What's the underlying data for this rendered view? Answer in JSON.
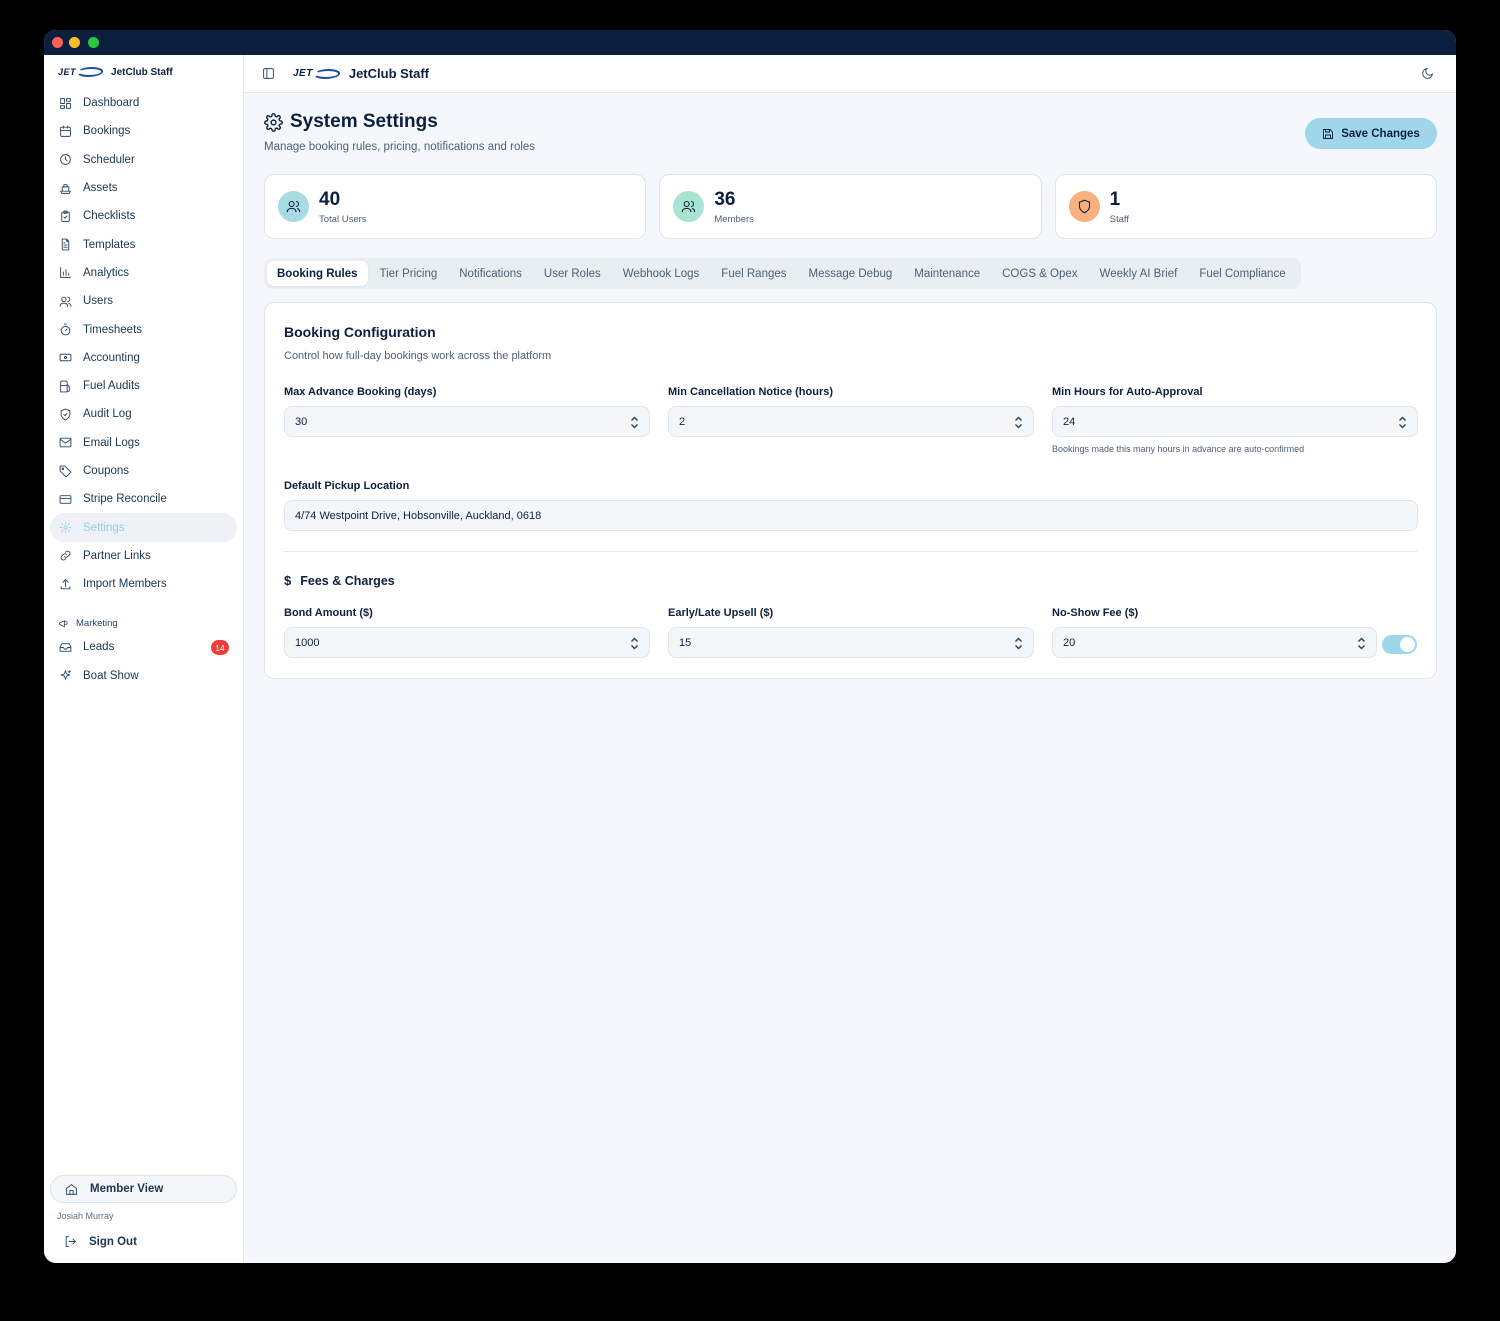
{
  "app": {
    "brand_logo_text": "JET",
    "brand_name": "JetClub Staff",
    "topbar_title": "JetClub Staff"
  },
  "sidebar": {
    "items": [
      {
        "label": "Dashboard",
        "icon": "layout-dashboard-icon"
      },
      {
        "label": "Bookings",
        "icon": "calendar-icon"
      },
      {
        "label": "Scheduler",
        "icon": "clock-icon"
      },
      {
        "label": "Assets",
        "icon": "boat-icon"
      },
      {
        "label": "Checklists",
        "icon": "clipboard-check-icon"
      },
      {
        "label": "Templates",
        "icon": "file-text-icon"
      },
      {
        "label": "Analytics",
        "icon": "bar-chart-icon"
      },
      {
        "label": "Users",
        "icon": "users-icon"
      },
      {
        "label": "Timesheets",
        "icon": "timer-icon"
      },
      {
        "label": "Accounting",
        "icon": "banknote-icon"
      },
      {
        "label": "Fuel Audits",
        "icon": "fuel-icon"
      },
      {
        "label": "Audit Log",
        "icon": "shield-check-icon"
      },
      {
        "label": "Email Logs",
        "icon": "mail-icon"
      },
      {
        "label": "Coupons",
        "icon": "tag-icon"
      },
      {
        "label": "Stripe Reconcile",
        "icon": "credit-card-icon"
      },
      {
        "label": "Settings",
        "icon": "gear-icon"
      },
      {
        "label": "Partner Links",
        "icon": "link-icon"
      },
      {
        "label": "Import Members",
        "icon": "upload-icon"
      }
    ],
    "marketing_label": "Marketing",
    "marketing_items": [
      {
        "label": "Leads",
        "icon": "inbox-icon",
        "badge": "14"
      },
      {
        "label": "Boat Show",
        "icon": "sparkles-icon"
      }
    ],
    "member_view": "Member View",
    "user_name": "Josiah Murray",
    "sign_out": "Sign Out"
  },
  "page": {
    "title": "System Settings",
    "subtitle": "Manage booking rules, pricing, notifications and roles",
    "save_label": "Save Changes"
  },
  "stats": [
    {
      "value": "40",
      "label": "Total Users",
      "color": "#a8dbe4"
    },
    {
      "value": "36",
      "label": "Members",
      "color": "#a9e4d2"
    },
    {
      "value": "1",
      "label": "Staff",
      "color": "#f9b07e"
    }
  ],
  "tabs": [
    "Booking Rules",
    "Tier Pricing",
    "Notifications",
    "User Roles",
    "Webhook Logs",
    "Fuel Ranges",
    "Message Debug",
    "Maintenance",
    "COGS & Opex",
    "Weekly AI Brief",
    "Fuel Compliance"
  ],
  "booking": {
    "title": "Booking Configuration",
    "subtitle": "Control how full-day bookings work across the platform",
    "max_advance_label": "Max Advance Booking (days)",
    "max_advance_value": "30",
    "min_cancel_label": "Min Cancellation Notice (hours)",
    "min_cancel_value": "2",
    "auto_approval_label": "Min Hours for Auto-Approval",
    "auto_approval_value": "24",
    "auto_approval_hint": "Bookings made this many hours in advance are auto-confirmed",
    "pickup_label": "Default Pickup Location",
    "pickup_value": "4/74 Westpoint Drive, Hobsonville, Auckland, 0618"
  },
  "fees": {
    "title": "Fees & Charges",
    "bond_label": "Bond Amount ($)",
    "bond_value": "1000",
    "upsell_label": "Early/Late Upsell ($)",
    "upsell_value": "15",
    "noshow_label": "No-Show Fee ($)",
    "noshow_value": "20",
    "noshow_enabled": true
  }
}
